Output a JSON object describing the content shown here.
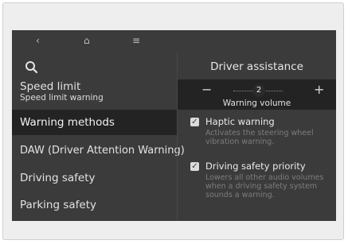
{
  "nav": {
    "back_icon": "‹",
    "home_icon": "⌂",
    "menu_icon": "≡"
  },
  "sidebar": {
    "items": [
      {
        "label": "Speed limit",
        "sublabel": "Speed limit warning"
      },
      {
        "label": "Warning methods"
      },
      {
        "label": "DAW (Driver Attention Warning)"
      },
      {
        "label": "Driving safety"
      },
      {
        "label": "Parking safety"
      }
    ],
    "active_index": 1
  },
  "panel": {
    "title": "Driver assistance",
    "volume": {
      "minus_label": "−",
      "plus_label": "+",
      "value": "2",
      "label": "Warning volume"
    },
    "options": [
      {
        "label": "Haptic warning",
        "checked": true,
        "description": "Activates the steering wheel vibration warning."
      },
      {
        "label": "Driving safety priority",
        "checked": true,
        "description": "Lowers all other audio volumes when a driving safety system sounds a warning."
      }
    ]
  },
  "colors": {
    "screen_bg": "#3b3b3b",
    "active_bg": "#232323",
    "text": "#e2e2e2",
    "muted_text": "#7d7d7d"
  }
}
